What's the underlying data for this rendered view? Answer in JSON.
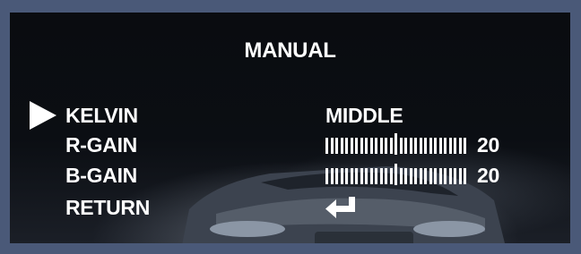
{
  "menu": {
    "title": "MANUAL",
    "selected_index": 0,
    "items": [
      {
        "label": "KELVIN",
        "value": "MIDDLE"
      },
      {
        "label": "R-GAIN",
        "value": "20",
        "level": 0.5
      },
      {
        "label": "B-GAIN",
        "value": "20",
        "level": 0.5
      },
      {
        "label": "RETURN",
        "icon": "return-arrow-icon"
      }
    ]
  },
  "colors": {
    "frame": "#4a5978",
    "text": "#ffffff",
    "screen": "#0b0e13"
  }
}
